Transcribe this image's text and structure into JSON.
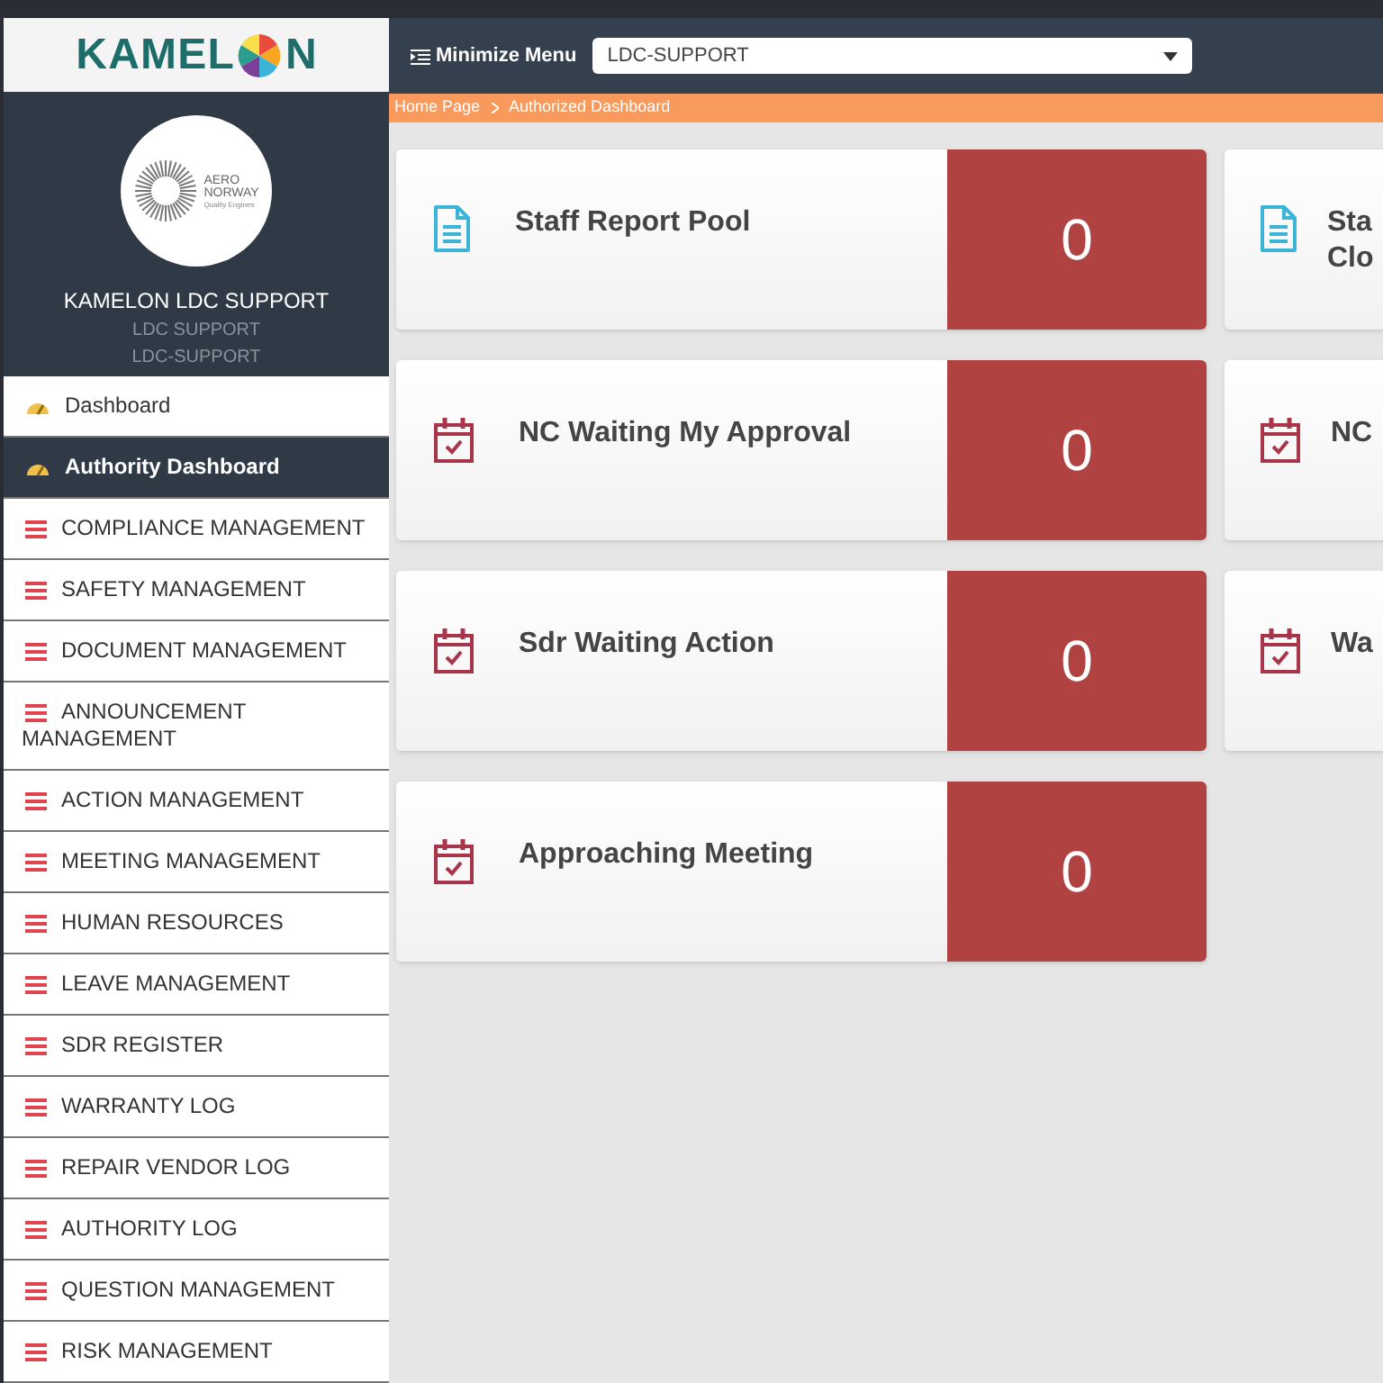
{
  "logo": {
    "text_before": "KAMEL",
    "text_after": "N"
  },
  "profile": {
    "badge_lines": [
      "AERO",
      "NORWAY",
      "Quality Engines"
    ],
    "name": "KAMELON LDC SUPPORT",
    "role": "LDC SUPPORT",
    "username": "LDC-SUPPORT"
  },
  "sidebar": {
    "items": [
      {
        "label": "Dashboard",
        "kind": "gauge",
        "selected": false
      },
      {
        "label": "Authority Dashboard",
        "kind": "gauge",
        "selected": true
      },
      {
        "label": "COMPLIANCE MANAGEMENT",
        "kind": "list",
        "selected": false
      },
      {
        "label": "SAFETY MANAGEMENT",
        "kind": "list",
        "selected": false
      },
      {
        "label": "DOCUMENT MANAGEMENT",
        "kind": "list",
        "selected": false
      },
      {
        "label": "ANNOUNCEMENT MANAGEMENT",
        "kind": "list",
        "selected": false
      },
      {
        "label": "ACTION MANAGEMENT",
        "kind": "list",
        "selected": false
      },
      {
        "label": "MEETING MANAGEMENT",
        "kind": "list",
        "selected": false
      },
      {
        "label": "HUMAN RESOURCES",
        "kind": "list",
        "selected": false
      },
      {
        "label": "LEAVE MANAGEMENT",
        "kind": "list",
        "selected": false
      },
      {
        "label": "SDR REGISTER",
        "kind": "list",
        "selected": false
      },
      {
        "label": "WARRANTY LOG",
        "kind": "list",
        "selected": false
      },
      {
        "label": "REPAIR VENDOR LOG",
        "kind": "list",
        "selected": false
      },
      {
        "label": "AUTHORITY LOG",
        "kind": "list",
        "selected": false
      },
      {
        "label": "QUESTION MANAGEMENT",
        "kind": "list",
        "selected": false
      },
      {
        "label": "RISK MANAGEMENT",
        "kind": "list",
        "selected": false
      }
    ]
  },
  "header": {
    "minimize_label": "Minimize Menu",
    "select_value": "LDC-SUPPORT"
  },
  "breadcrumb": [
    "Home Page",
    "Authorized Dashboard"
  ],
  "cards": [
    {
      "title": "Staff Report Pool",
      "count": "0",
      "kind": "document"
    },
    {
      "title": "NC Waiting My Approval",
      "count": "0",
      "kind": "calendar"
    },
    {
      "title": "Sdr Waiting Action",
      "count": "0",
      "kind": "calendar"
    },
    {
      "title": "Approaching Meeting",
      "count": "0",
      "kind": "calendar"
    }
  ],
  "cards_column_2": [
    {
      "title": "Sta\nClo",
      "kind": "document"
    },
    {
      "title": "NC",
      "kind": "calendar"
    },
    {
      "title": "Wa",
      "kind": "calendar"
    }
  ]
}
